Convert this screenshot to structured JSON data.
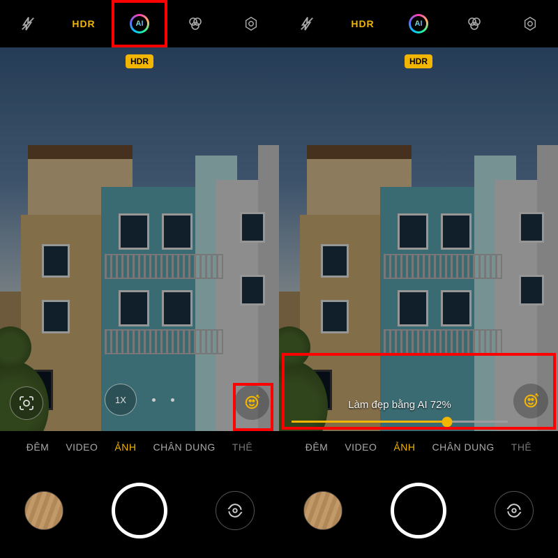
{
  "topbar": {
    "flash": "flash-off-icon",
    "hdr_label": "HDR",
    "ai_label": "AI",
    "filter": "filter-icon",
    "settings": "settings-icon"
  },
  "viewfinder": {
    "hdr_badge": "HDR",
    "zoom_label": "1X"
  },
  "modes": {
    "items": [
      "ĐÊM",
      "VIDEO",
      "ẢNH",
      "CHÂN DUNG",
      "THÊ"
    ],
    "active_index": 2
  },
  "slider": {
    "label": "Làm đẹp bằng AI 72%",
    "value_pct": 72
  },
  "colors": {
    "accent": "#f3b600",
    "highlight": "#ff0000"
  }
}
